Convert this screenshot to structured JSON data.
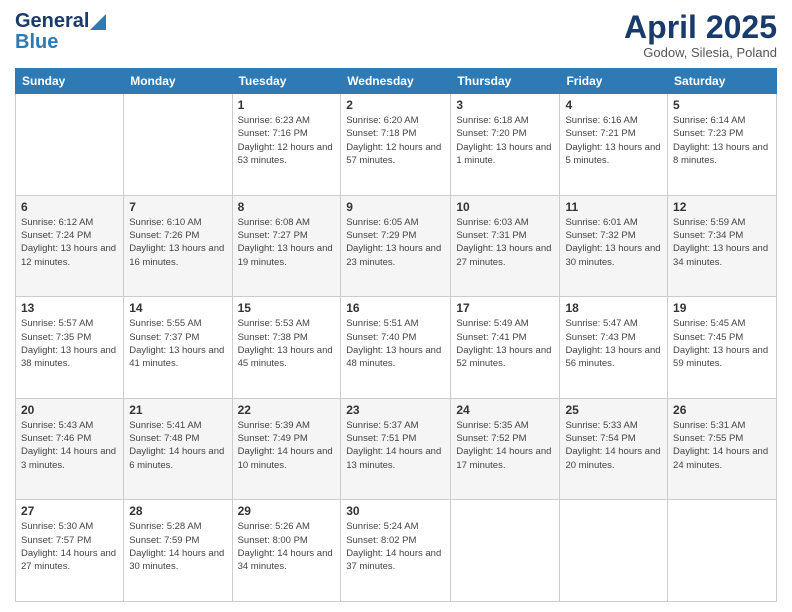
{
  "logo": {
    "general": "General",
    "blue": "Blue"
  },
  "title": "April 2025",
  "location": "Godow, Silesia, Poland",
  "days_of_week": [
    "Sunday",
    "Monday",
    "Tuesday",
    "Wednesday",
    "Thursday",
    "Friday",
    "Saturday"
  ],
  "weeks": [
    [
      {
        "day": null
      },
      {
        "day": null
      },
      {
        "day": "1",
        "sunrise": "Sunrise: 6:23 AM",
        "sunset": "Sunset: 7:16 PM",
        "daylight": "Daylight: 12 hours and 53 minutes."
      },
      {
        "day": "2",
        "sunrise": "Sunrise: 6:20 AM",
        "sunset": "Sunset: 7:18 PM",
        "daylight": "Daylight: 12 hours and 57 minutes."
      },
      {
        "day": "3",
        "sunrise": "Sunrise: 6:18 AM",
        "sunset": "Sunset: 7:20 PM",
        "daylight": "Daylight: 13 hours and 1 minute."
      },
      {
        "day": "4",
        "sunrise": "Sunrise: 6:16 AM",
        "sunset": "Sunset: 7:21 PM",
        "daylight": "Daylight: 13 hours and 5 minutes."
      },
      {
        "day": "5",
        "sunrise": "Sunrise: 6:14 AM",
        "sunset": "Sunset: 7:23 PM",
        "daylight": "Daylight: 13 hours and 8 minutes."
      }
    ],
    [
      {
        "day": "6",
        "sunrise": "Sunrise: 6:12 AM",
        "sunset": "Sunset: 7:24 PM",
        "daylight": "Daylight: 13 hours and 12 minutes."
      },
      {
        "day": "7",
        "sunrise": "Sunrise: 6:10 AM",
        "sunset": "Sunset: 7:26 PM",
        "daylight": "Daylight: 13 hours and 16 minutes."
      },
      {
        "day": "8",
        "sunrise": "Sunrise: 6:08 AM",
        "sunset": "Sunset: 7:27 PM",
        "daylight": "Daylight: 13 hours and 19 minutes."
      },
      {
        "day": "9",
        "sunrise": "Sunrise: 6:05 AM",
        "sunset": "Sunset: 7:29 PM",
        "daylight": "Daylight: 13 hours and 23 minutes."
      },
      {
        "day": "10",
        "sunrise": "Sunrise: 6:03 AM",
        "sunset": "Sunset: 7:31 PM",
        "daylight": "Daylight: 13 hours and 27 minutes."
      },
      {
        "day": "11",
        "sunrise": "Sunrise: 6:01 AM",
        "sunset": "Sunset: 7:32 PM",
        "daylight": "Daylight: 13 hours and 30 minutes."
      },
      {
        "day": "12",
        "sunrise": "Sunrise: 5:59 AM",
        "sunset": "Sunset: 7:34 PM",
        "daylight": "Daylight: 13 hours and 34 minutes."
      }
    ],
    [
      {
        "day": "13",
        "sunrise": "Sunrise: 5:57 AM",
        "sunset": "Sunset: 7:35 PM",
        "daylight": "Daylight: 13 hours and 38 minutes."
      },
      {
        "day": "14",
        "sunrise": "Sunrise: 5:55 AM",
        "sunset": "Sunset: 7:37 PM",
        "daylight": "Daylight: 13 hours and 41 minutes."
      },
      {
        "day": "15",
        "sunrise": "Sunrise: 5:53 AM",
        "sunset": "Sunset: 7:38 PM",
        "daylight": "Daylight: 13 hours and 45 minutes."
      },
      {
        "day": "16",
        "sunrise": "Sunrise: 5:51 AM",
        "sunset": "Sunset: 7:40 PM",
        "daylight": "Daylight: 13 hours and 48 minutes."
      },
      {
        "day": "17",
        "sunrise": "Sunrise: 5:49 AM",
        "sunset": "Sunset: 7:41 PM",
        "daylight": "Daylight: 13 hours and 52 minutes."
      },
      {
        "day": "18",
        "sunrise": "Sunrise: 5:47 AM",
        "sunset": "Sunset: 7:43 PM",
        "daylight": "Daylight: 13 hours and 56 minutes."
      },
      {
        "day": "19",
        "sunrise": "Sunrise: 5:45 AM",
        "sunset": "Sunset: 7:45 PM",
        "daylight": "Daylight: 13 hours and 59 minutes."
      }
    ],
    [
      {
        "day": "20",
        "sunrise": "Sunrise: 5:43 AM",
        "sunset": "Sunset: 7:46 PM",
        "daylight": "Daylight: 14 hours and 3 minutes."
      },
      {
        "day": "21",
        "sunrise": "Sunrise: 5:41 AM",
        "sunset": "Sunset: 7:48 PM",
        "daylight": "Daylight: 14 hours and 6 minutes."
      },
      {
        "day": "22",
        "sunrise": "Sunrise: 5:39 AM",
        "sunset": "Sunset: 7:49 PM",
        "daylight": "Daylight: 14 hours and 10 minutes."
      },
      {
        "day": "23",
        "sunrise": "Sunrise: 5:37 AM",
        "sunset": "Sunset: 7:51 PM",
        "daylight": "Daylight: 14 hours and 13 minutes."
      },
      {
        "day": "24",
        "sunrise": "Sunrise: 5:35 AM",
        "sunset": "Sunset: 7:52 PM",
        "daylight": "Daylight: 14 hours and 17 minutes."
      },
      {
        "day": "25",
        "sunrise": "Sunrise: 5:33 AM",
        "sunset": "Sunset: 7:54 PM",
        "daylight": "Daylight: 14 hours and 20 minutes."
      },
      {
        "day": "26",
        "sunrise": "Sunrise: 5:31 AM",
        "sunset": "Sunset: 7:55 PM",
        "daylight": "Daylight: 14 hours and 24 minutes."
      }
    ],
    [
      {
        "day": "27",
        "sunrise": "Sunrise: 5:30 AM",
        "sunset": "Sunset: 7:57 PM",
        "daylight": "Daylight: 14 hours and 27 minutes."
      },
      {
        "day": "28",
        "sunrise": "Sunrise: 5:28 AM",
        "sunset": "Sunset: 7:59 PM",
        "daylight": "Daylight: 14 hours and 30 minutes."
      },
      {
        "day": "29",
        "sunrise": "Sunrise: 5:26 AM",
        "sunset": "Sunset: 8:00 PM",
        "daylight": "Daylight: 14 hours and 34 minutes."
      },
      {
        "day": "30",
        "sunrise": "Sunrise: 5:24 AM",
        "sunset": "Sunset: 8:02 PM",
        "daylight": "Daylight: 14 hours and 37 minutes."
      },
      {
        "day": null
      },
      {
        "day": null
      },
      {
        "day": null
      }
    ]
  ]
}
